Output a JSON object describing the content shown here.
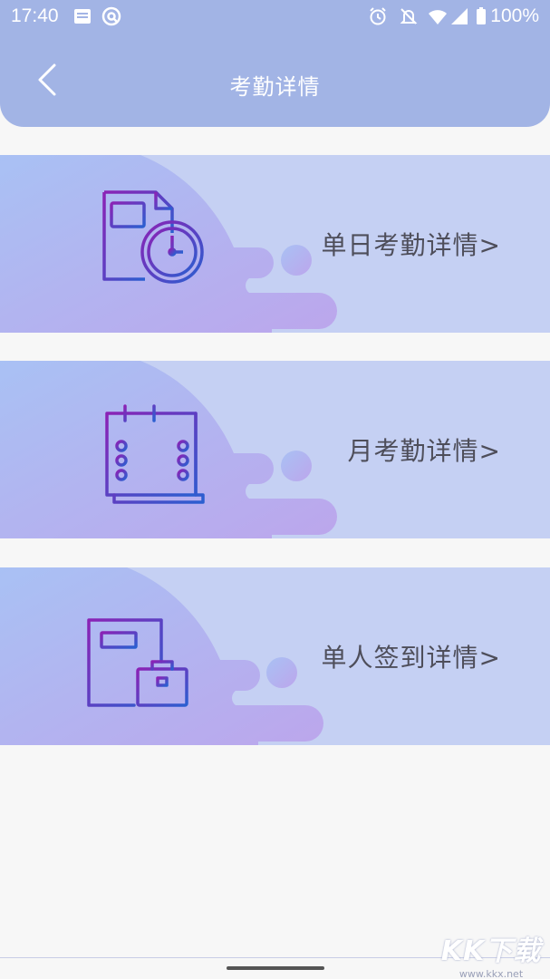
{
  "status_bar": {
    "time": "17:40",
    "battery": "100%"
  },
  "header": {
    "title": "考勤详情"
  },
  "cards": [
    {
      "label": "单日考勤详情>",
      "icon": "document-clock-icon"
    },
    {
      "label": "月考勤详情>",
      "icon": "calendar-list-icon"
    },
    {
      "label": "单人签到详情>",
      "icon": "document-briefcase-icon"
    }
  ],
  "watermark": {
    "logo": "KK下载",
    "url": "www.kkx.net"
  },
  "colors": {
    "header_bg": "#a2b4e5",
    "card_bg": "#c5d0f3",
    "icon_gradient_start": "#8b22b5",
    "icon_gradient_end": "#2a5fd0"
  }
}
